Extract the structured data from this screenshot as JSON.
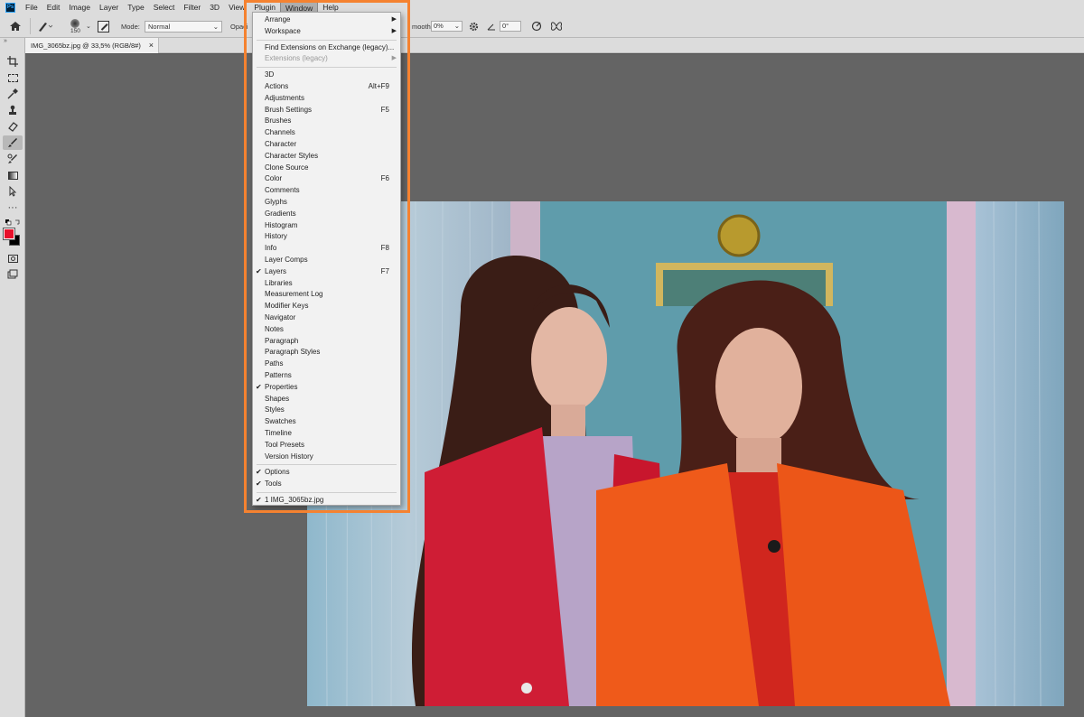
{
  "app": {
    "logo_text": "Ps"
  },
  "menubar": {
    "items": [
      "File",
      "Edit",
      "Image",
      "Layer",
      "Type",
      "Select",
      "Filter",
      "3D",
      "View",
      "Plugin",
      "Window",
      "Help"
    ],
    "active_index": 10
  },
  "options": {
    "brush_size": "150",
    "mode_label": "Mode:",
    "mode_value": "Normal",
    "opacity_label": "Opaci",
    "smoothing_label": "moothing:",
    "smoothing_value": "0%",
    "angle_value": "0°"
  },
  "document": {
    "tab_title": "IMG_3065bz.jpg @ 33,5% (RGB/8#)",
    "close_glyph": "×"
  },
  "window_menu": {
    "sections": [
      [
        {
          "label": "Arrange",
          "submenu": true
        },
        {
          "label": "Workspace",
          "submenu": true
        }
      ],
      [
        {
          "label": "Find Extensions on Exchange (legacy)..."
        },
        {
          "label": "Extensions (legacy)",
          "submenu": true,
          "disabled": true
        }
      ],
      [
        {
          "label": "3D"
        },
        {
          "label": "Actions",
          "shortcut": "Alt+F9"
        },
        {
          "label": "Adjustments"
        },
        {
          "label": "Brush Settings",
          "shortcut": "F5"
        },
        {
          "label": "Brushes"
        },
        {
          "label": "Channels"
        },
        {
          "label": "Character"
        },
        {
          "label": "Character Styles"
        },
        {
          "label": "Clone Source"
        },
        {
          "label": "Color",
          "shortcut": "F6"
        },
        {
          "label": "Comments"
        },
        {
          "label": "Glyphs"
        },
        {
          "label": "Gradients"
        },
        {
          "label": "Histogram"
        },
        {
          "label": "History"
        },
        {
          "label": "Info",
          "shortcut": "F8"
        },
        {
          "label": "Layer Comps"
        },
        {
          "label": "Layers",
          "shortcut": "F7",
          "checked": true
        },
        {
          "label": "Libraries"
        },
        {
          "label": "Measurement Log"
        },
        {
          "label": "Modifier Keys"
        },
        {
          "label": "Navigator"
        },
        {
          "label": "Notes"
        },
        {
          "label": "Paragraph"
        },
        {
          "label": "Paragraph Styles"
        },
        {
          "label": "Paths"
        },
        {
          "label": "Patterns"
        },
        {
          "label": "Properties",
          "checked": true
        },
        {
          "label": "Shapes"
        },
        {
          "label": "Styles"
        },
        {
          "label": "Swatches"
        },
        {
          "label": "Timeline"
        },
        {
          "label": "Tool Presets"
        },
        {
          "label": "Version History"
        }
      ],
      [
        {
          "label": "Options",
          "checked": true
        },
        {
          "label": "Tools",
          "checked": true
        }
      ],
      [
        {
          "label": "1 IMG_3065bz.jpg",
          "checked": true
        }
      ]
    ]
  },
  "colors": {
    "foreground": "#e8102a",
    "background": "#000000",
    "highlight_border": "#f58230"
  },
  "icons": {
    "home": "home-icon",
    "brush": "brush-icon",
    "settings": "gear-icon",
    "symmetry": "butterfly-icon"
  }
}
